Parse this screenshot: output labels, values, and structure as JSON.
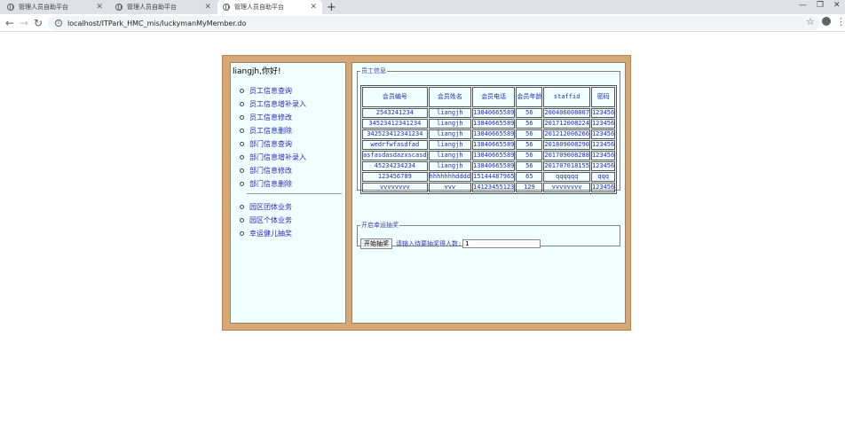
{
  "browser": {
    "tabs": [
      {
        "title": "管理人员自助平台",
        "active": false
      },
      {
        "title": "管理人员自助平台",
        "active": false
      },
      {
        "title": "管理人员自助平台",
        "active": true
      }
    ],
    "url": "localhost/ITPark_HMC_mis/luckymanMyMember.do"
  },
  "sidebar": {
    "greeting": "liangjh,你好!",
    "menu_group1": [
      "员工信息查询",
      "员工信息增补录入",
      "员工信息修改",
      "员工信息删除",
      "部门信息查询",
      "部门信息增补录入",
      "部门信息修改",
      "部门信息删除"
    ],
    "menu_group2": [
      "园区团体业务",
      "园区个体业务",
      "幸运健儿抽奖"
    ]
  },
  "staff": {
    "legend": "员工信息",
    "headers": [
      "会员编号",
      "会员姓名",
      "会员电话",
      "会员年龄",
      "staffid",
      "密码"
    ],
    "rows": [
      [
        "2543241234",
        "liangjh",
        "13840665589",
        "56",
        "200406008007",
        "123456"
      ],
      [
        "34523412341234",
        "liangjh",
        "13840665589",
        "56",
        "201712008224",
        "123456"
      ],
      [
        "342523412341234",
        "liangjh",
        "13840665589",
        "56",
        "201212006266",
        "123456"
      ],
      [
        "wedrfwfasdfad",
        "liangjh",
        "13840665589",
        "56",
        "201809008290",
        "123456"
      ],
      [
        "asfasdasdazxscasd",
        "liangjh",
        "13840665589",
        "56",
        "201709008288",
        "123456"
      ],
      [
        "45234234234",
        "liangjh",
        "13840665589",
        "56",
        "201707018155",
        "123456"
      ],
      [
        "123456789",
        "hhhhhhhdddd",
        "15144487965",
        "65",
        "qqqqqq",
        "qqq"
      ],
      [
        "vvvvvvvv",
        "vvv",
        "14123455123",
        "129",
        "vvvvvvvv",
        "123456"
      ]
    ]
  },
  "lottery": {
    "legend": "开启幸运抽奖",
    "button_label": "开始抽奖",
    "input_label": "请输入待要抽奖得人数:",
    "input_value": "1"
  }
}
